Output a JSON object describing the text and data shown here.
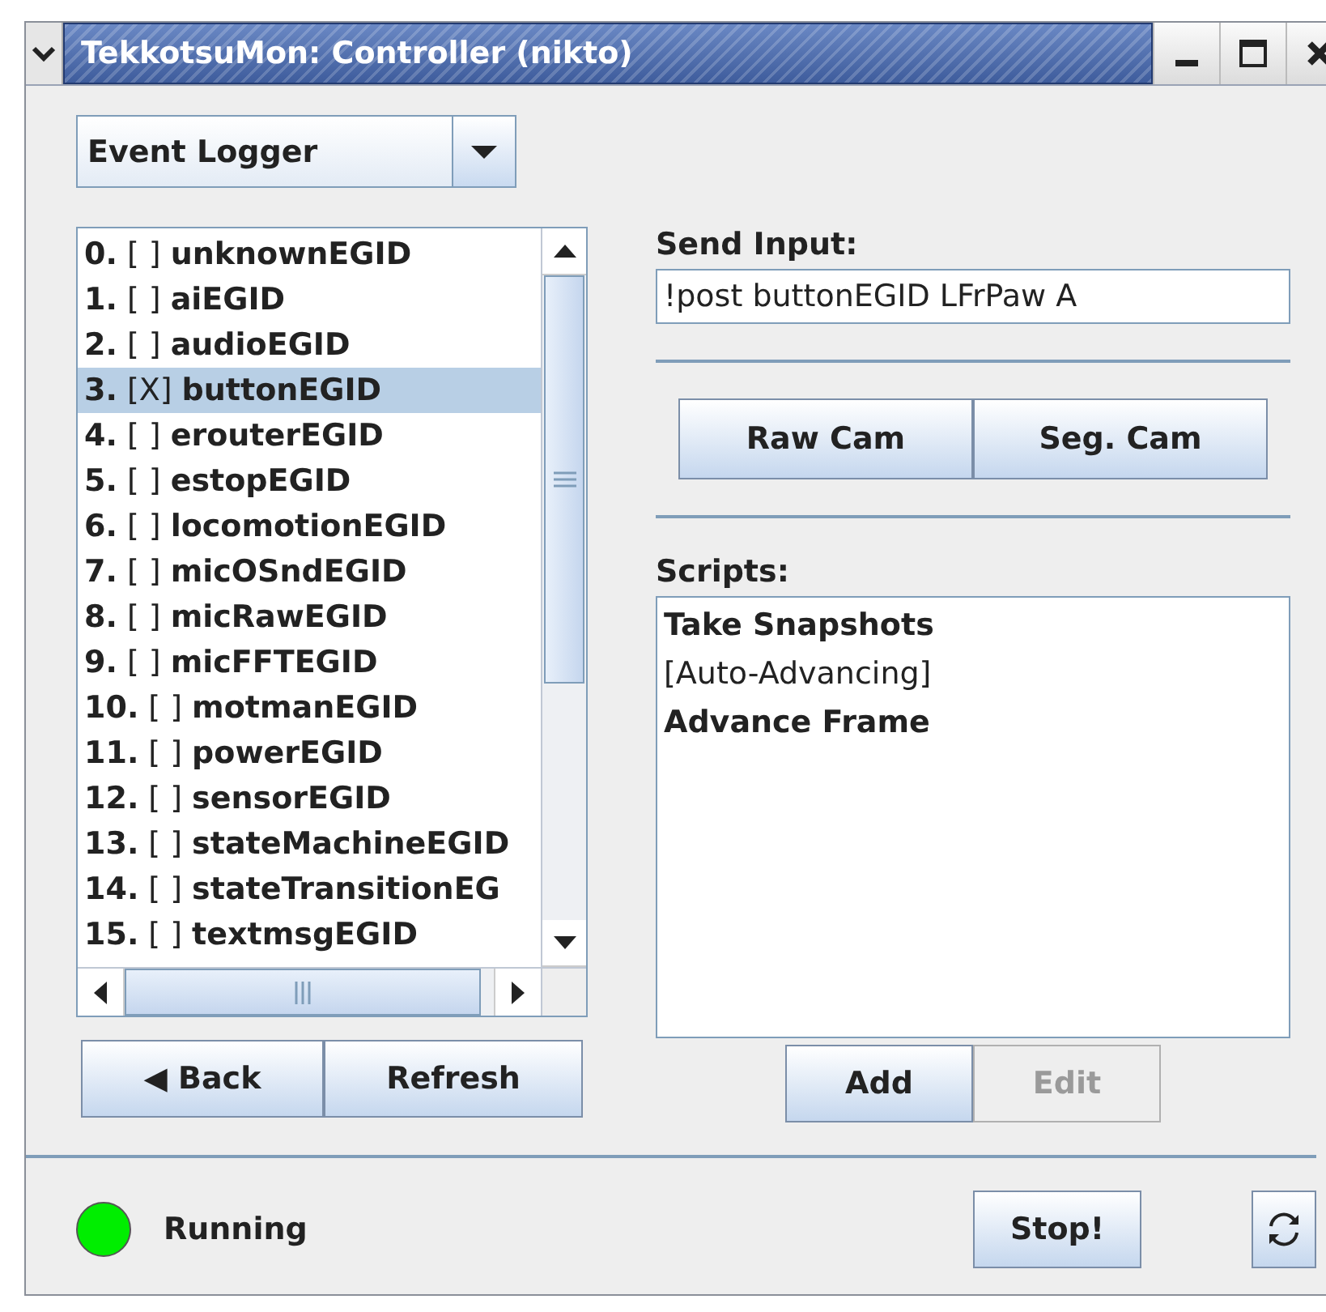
{
  "window": {
    "title": "TekkotsuMon: Controller (nikto)"
  },
  "mode_select": {
    "value": "Event Logger"
  },
  "event_list": {
    "rows": [
      {
        "number": "0.",
        "box": "[ ]",
        "name": "unknownEGID",
        "selected": false
      },
      {
        "number": "1.",
        "box": "[ ]",
        "name": "aiEGID",
        "selected": false
      },
      {
        "number": "2.",
        "box": "[ ]",
        "name": "audioEGID",
        "selected": false
      },
      {
        "number": "3.",
        "box": "[X]",
        "name": "buttonEGID",
        "selected": true
      },
      {
        "number": "4.",
        "box": "[ ]",
        "name": "erouterEGID",
        "selected": false
      },
      {
        "number": "5.",
        "box": "[ ]",
        "name": "estopEGID",
        "selected": false
      },
      {
        "number": "6.",
        "box": "[ ]",
        "name": "locomotionEGID",
        "selected": false
      },
      {
        "number": "7.",
        "box": "[ ]",
        "name": "micOSndEGID",
        "selected": false
      },
      {
        "number": "8.",
        "box": "[ ]",
        "name": "micRawEGID",
        "selected": false
      },
      {
        "number": "9.",
        "box": "[ ]",
        "name": "micFFTEGID",
        "selected": false
      },
      {
        "number": "10.",
        "box": "[ ]",
        "name": "motmanEGID",
        "selected": false
      },
      {
        "number": "11.",
        "box": "[ ]",
        "name": "powerEGID",
        "selected": false
      },
      {
        "number": "12.",
        "box": "[ ]",
        "name": "sensorEGID",
        "selected": false
      },
      {
        "number": "13.",
        "box": "[ ]",
        "name": "stateMachineEGID",
        "selected": false
      },
      {
        "number": "14.",
        "box": "[ ]",
        "name": "stateTransitionEG",
        "selected": false
      },
      {
        "number": "15.",
        "box": "[ ]",
        "name": "textmsgEGID",
        "selected": false
      }
    ]
  },
  "nav_buttons": [
    {
      "label": "◀ Back",
      "disabled": false
    },
    {
      "label": "Refresh",
      "disabled": false
    }
  ],
  "send_input": {
    "label": "Send Input:",
    "value": "!post buttonEGID LFrPaw A"
  },
  "cam_buttons": [
    {
      "label": "Raw Cam",
      "disabled": false
    },
    {
      "label": "Seg. Cam",
      "disabled": false
    }
  ],
  "scripts": {
    "label": "Scripts:",
    "items": [
      {
        "text": "Take Snapshots",
        "bold": true
      },
      {
        "text": "[Auto-Advancing]",
        "bold": false
      },
      {
        "text": "Advance Frame",
        "bold": true
      }
    ]
  },
  "script_buttons": [
    {
      "label": "Add",
      "disabled": false
    },
    {
      "label": "Edit",
      "disabled": true
    }
  ],
  "status": {
    "text": "Running",
    "color": "#00ee00"
  },
  "stop_button": {
    "label": "Stop!"
  }
}
